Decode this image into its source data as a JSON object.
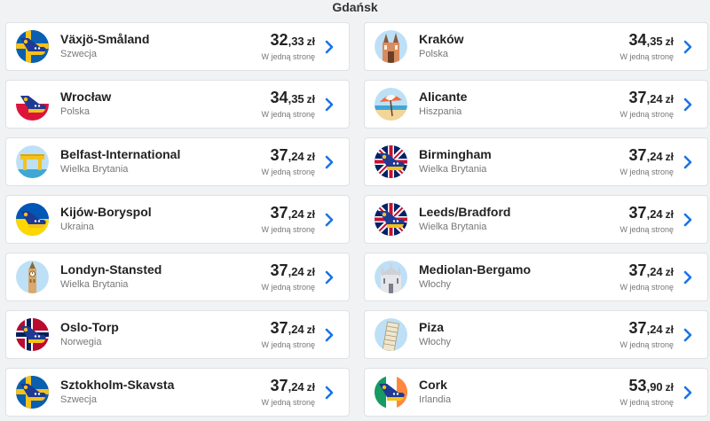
{
  "header": {
    "title": "Gdańsk"
  },
  "colors": {
    "chevron": "#1a73e8",
    "card_bg": "#ffffff",
    "page_bg": "#f1f2f4"
  },
  "destinations": [
    {
      "city": "Växjö-Småland",
      "country": "Szwecja",
      "price_main": "32",
      "price_dec": ",33",
      "currency": "zł",
      "note": "W jedną stronę",
      "icon": "plane-sweden-icon"
    },
    {
      "city": "Kraków",
      "country": "Polska",
      "price_main": "34",
      "price_dec": ",35",
      "currency": "zł",
      "note": "W jedną stronę",
      "icon": "church-landmark-icon"
    },
    {
      "city": "Wrocław",
      "country": "Polska",
      "price_main": "34",
      "price_dec": ",35",
      "currency": "zł",
      "note": "W jedną stronę",
      "icon": "plane-poland-icon"
    },
    {
      "city": "Alicante",
      "country": "Hiszpania",
      "price_main": "37",
      "price_dec": ",24",
      "currency": "zł",
      "note": "W jedną stronę",
      "icon": "beach-umbrella-icon"
    },
    {
      "city": "Belfast-International",
      "country": "Wielka Brytania",
      "price_main": "37",
      "price_dec": ",24",
      "currency": "zł",
      "note": "W jedną stronę",
      "icon": "shipyard-crane-icon"
    },
    {
      "city": "Birmingham",
      "country": "Wielka Brytania",
      "price_main": "37",
      "price_dec": ",24",
      "currency": "zł",
      "note": "W jedną stronę",
      "icon": "plane-uk-icon"
    },
    {
      "city": "Kijów-Boryspol",
      "country": "Ukraina",
      "price_main": "37",
      "price_dec": ",24",
      "currency": "zł",
      "note": "W jedną stronę",
      "icon": "plane-ukraine-icon"
    },
    {
      "city": "Leeds/Bradford",
      "country": "Wielka Brytania",
      "price_main": "37",
      "price_dec": ",24",
      "currency": "zł",
      "note": "W jedną stronę",
      "icon": "plane-uk-icon"
    },
    {
      "city": "Londyn-Stansted",
      "country": "Wielka Brytania",
      "price_main": "37",
      "price_dec": ",24",
      "currency": "zł",
      "note": "W jedną stronę",
      "icon": "big-ben-icon"
    },
    {
      "city": "Mediolan-Bergamo",
      "country": "Włochy",
      "price_main": "37",
      "price_dec": ",24",
      "currency": "zł",
      "note": "W jedną stronę",
      "icon": "cathedral-icon"
    },
    {
      "city": "Oslo-Torp",
      "country": "Norwegia",
      "price_main": "37",
      "price_dec": ",24",
      "currency": "zł",
      "note": "W jedną stronę",
      "icon": "plane-norway-icon"
    },
    {
      "city": "Piza",
      "country": "Włochy",
      "price_main": "37",
      "price_dec": ",24",
      "currency": "zł",
      "note": "W jedną stronę",
      "icon": "leaning-tower-icon"
    },
    {
      "city": "Sztokholm-Skavsta",
      "country": "Szwecja",
      "price_main": "37",
      "price_dec": ",24",
      "currency": "zł",
      "note": "W jedną stronę",
      "icon": "plane-sweden-icon"
    },
    {
      "city": "Cork",
      "country": "Irlandia",
      "price_main": "53",
      "price_dec": ",90",
      "currency": "zł",
      "note": "W jedną stronę",
      "icon": "plane-ireland-icon"
    }
  ]
}
